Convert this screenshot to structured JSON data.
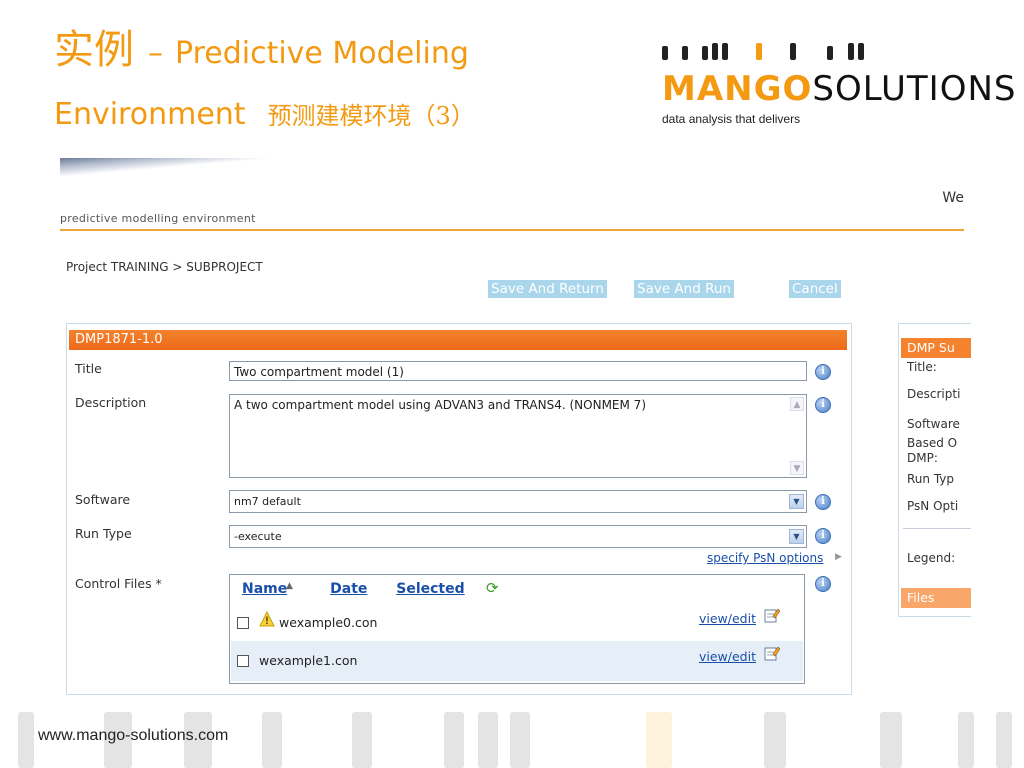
{
  "slide": {
    "title_cn": "实例",
    "title_dash": "–",
    "title_en_1": "Predictive Modeling",
    "title_en_2": "Environment",
    "title_cn_2": "预测建模环境（3）",
    "footer_url": "www.mango-solutions.com"
  },
  "logo": {
    "word_mango": "MANGO",
    "word_solutions": "SOLUTIONS",
    "tagline": "data analysis that delivers"
  },
  "app": {
    "welcome": "We",
    "name": "predictive modelling environment",
    "breadcrumb": "Project TRAINING > SUBPROJECT",
    "buttons": {
      "save_return": "Save And Return",
      "save_run": "Save And Run",
      "cancel": "Cancel"
    },
    "panel": {
      "header": "DMP1871-1.0",
      "title_label": "Title",
      "title_value": "Two compartment model (1)",
      "description_label": "Description",
      "description_value": "A two compartment model using ADVAN3 and TRANS4. (NONMEM 7)",
      "software_label": "Software",
      "software_value": "nm7 default",
      "runtype_label": "Run Type",
      "runtype_value": "-execute",
      "psn_link": "specify PsN options",
      "control_files_label": "Control Files *",
      "files_columns": [
        "Name",
        "Date",
        "Selected"
      ],
      "files": [
        {
          "name": "wexample0.con",
          "warning": true,
          "action": "view/edit"
        },
        {
          "name": "wexample1.con",
          "warning": false,
          "action": "view/edit"
        }
      ]
    },
    "side": {
      "header": "DMP Su",
      "labels": [
        "Title:",
        "Descripti",
        "Software",
        "Based O",
        "DMP:",
        "Run Typ",
        "PsN Opti",
        "Legend:"
      ],
      "files": "Files"
    }
  }
}
